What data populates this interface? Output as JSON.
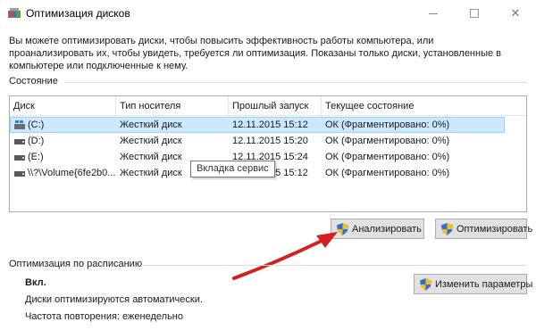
{
  "window": {
    "title": "Оптимизация дисков",
    "icon": "defrag-app-icon"
  },
  "description": "Вы можете оптимизировать диски, чтобы повысить эффективность работы  компьютера, или проанализировать их, чтобы увидеть, требуется ли оптимизация. Показаны только диски, установленные в компьютере или подключенные к нему.",
  "status_section": {
    "label": "Состояние",
    "columns": [
      "Диск",
      "Тип носителя",
      "Прошлый запуск",
      "Текущее состояние"
    ],
    "rows": [
      {
        "drive": "(C:)",
        "media": "Жесткий диск",
        "last_run": "12.11.2015 15:12",
        "state": "ОК (Фрагментировано: 0%)",
        "icon": "windows-drive-icon",
        "selected": true
      },
      {
        "drive": "(D:)",
        "media": "Жесткий диск",
        "last_run": "12.11.2015 15:20",
        "state": "ОК (Фрагментировано: 0%)",
        "icon": "hard-drive-icon",
        "selected": false
      },
      {
        "drive": "(E:)",
        "media": "Жесткий диск",
        "last_run": "12.11.2015 15:24",
        "state": "ОК (Фрагментировано: 0%)",
        "icon": "hard-drive-icon",
        "selected": false
      },
      {
        "drive": "\\\\?\\Volume{6fe2b0...",
        "media": "Жесткий диск",
        "last_run": "12.11.2015 15:12",
        "state": "ОК (Фрагментировано: 0%)",
        "icon": "hard-drive-icon",
        "selected": false
      }
    ],
    "tooltip": "Вкладка сервис"
  },
  "buttons": {
    "analyze": "Анализировать",
    "optimize": "Оптимизировать",
    "change_params": "Изменить параметры"
  },
  "schedule": {
    "label": "Оптимизация по расписанию",
    "status": "Вкл.",
    "auto_text": "Диски оптимизируются автоматически.",
    "frequency": "Частота повторения: еженедельно"
  },
  "colors": {
    "selection": "#cce8ff",
    "arrow": "#d42020",
    "button_bg": "#e1e1e1"
  }
}
